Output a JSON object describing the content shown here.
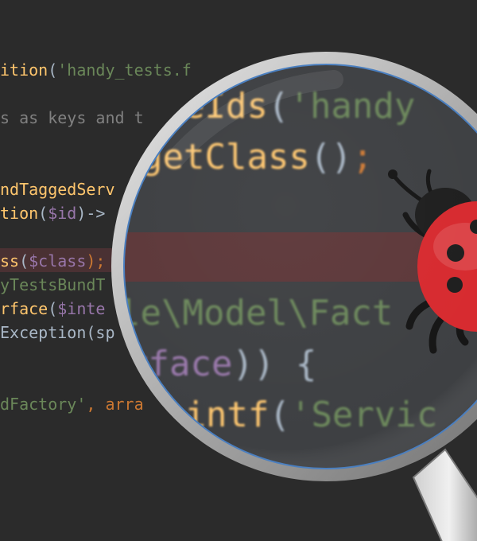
{
  "background_color": "#2b2b2b",
  "code_lines": [
    {
      "segments": [
        {
          "t": "ition",
          "c": "fn"
        },
        {
          "t": "(",
          "c": "plain"
        },
        {
          "t": "'handy_tests.f",
          "c": "str"
        }
      ]
    },
    {
      "segments": [
        {
          "t": "s as keys and t",
          "c": "cmt"
        }
      ]
    },
    {
      "segments": [
        {
          "t": "ndTaggedServ",
          "c": "fn"
        }
      ]
    },
    {
      "segments": [
        {
          "t": "tion",
          "c": "fn"
        },
        {
          "t": "(",
          "c": "plain"
        },
        {
          "t": "$id",
          "c": "var"
        },
        {
          "t": ")->",
          "c": "plain"
        }
      ]
    },
    {
      "segments": [
        {
          "t": "ss",
          "c": "fn"
        },
        {
          "t": "(",
          "c": "plain"
        },
        {
          "t": "$class",
          "c": "var"
        },
        {
          "t": ");",
          "c": "kw"
        }
      ]
    },
    {
      "segments": [
        {
          "t": "yTestsBundT",
          "c": "str"
        }
      ]
    },
    {
      "segments": [
        {
          "t": "rface",
          "c": "fn"
        },
        {
          "t": "(",
          "c": "plain"
        },
        {
          "t": "$inte",
          "c": "var"
        }
      ]
    },
    {
      "segments": [
        {
          "t": "Exception",
          "c": "plain"
        },
        {
          "t": "(sp",
          "c": "plain"
        }
      ]
    },
    {
      "segments": [
        {
          "t": "dFactory'",
          "c": "str"
        },
        {
          "t": ", ",
          "c": "kw"
        },
        {
          "t": "arra",
          "c": "kw"
        }
      ]
    }
  ],
  "zoom_lines": [
    {
      "segments": [
        {
          "t": "iceIds",
          "c": "fn"
        },
        {
          "t": "(",
          "c": "plain"
        },
        {
          "t": "'handy",
          "c": "str"
        }
      ]
    },
    {
      "segments": [
        {
          "t": "getClass",
          "c": "fn"
        },
        {
          "t": "()",
          "c": "plain"
        },
        {
          "t": ";",
          "c": "kw"
        }
      ]
    },
    {
      "segments": [
        {
          "t": "le\\Model\\Fact",
          "c": "str"
        }
      ]
    },
    {
      "segments": [
        {
          "t": "rface",
          "c": "var"
        },
        {
          "t": ")) {",
          "c": "plain"
        }
      ]
    },
    {
      "segments": [
        {
          "t": "sintf",
          "c": "fn"
        },
        {
          "t": "(",
          "c": "plain"
        },
        {
          "t": "'Servic",
          "c": "str"
        }
      ]
    }
  ],
  "colors": {
    "keyword": "#cc7832",
    "function": "#ffc66d",
    "string": "#6a8759",
    "variable": "#9876aa",
    "comment": "#808080",
    "text": "#a9b7c6",
    "highlight_line": "#4a3133",
    "ladybug_shell": "#d6262b",
    "ladybug_spots": "#1a1a1a"
  },
  "icons": [
    "magnifying-glass-icon",
    "ladybug-icon"
  ]
}
